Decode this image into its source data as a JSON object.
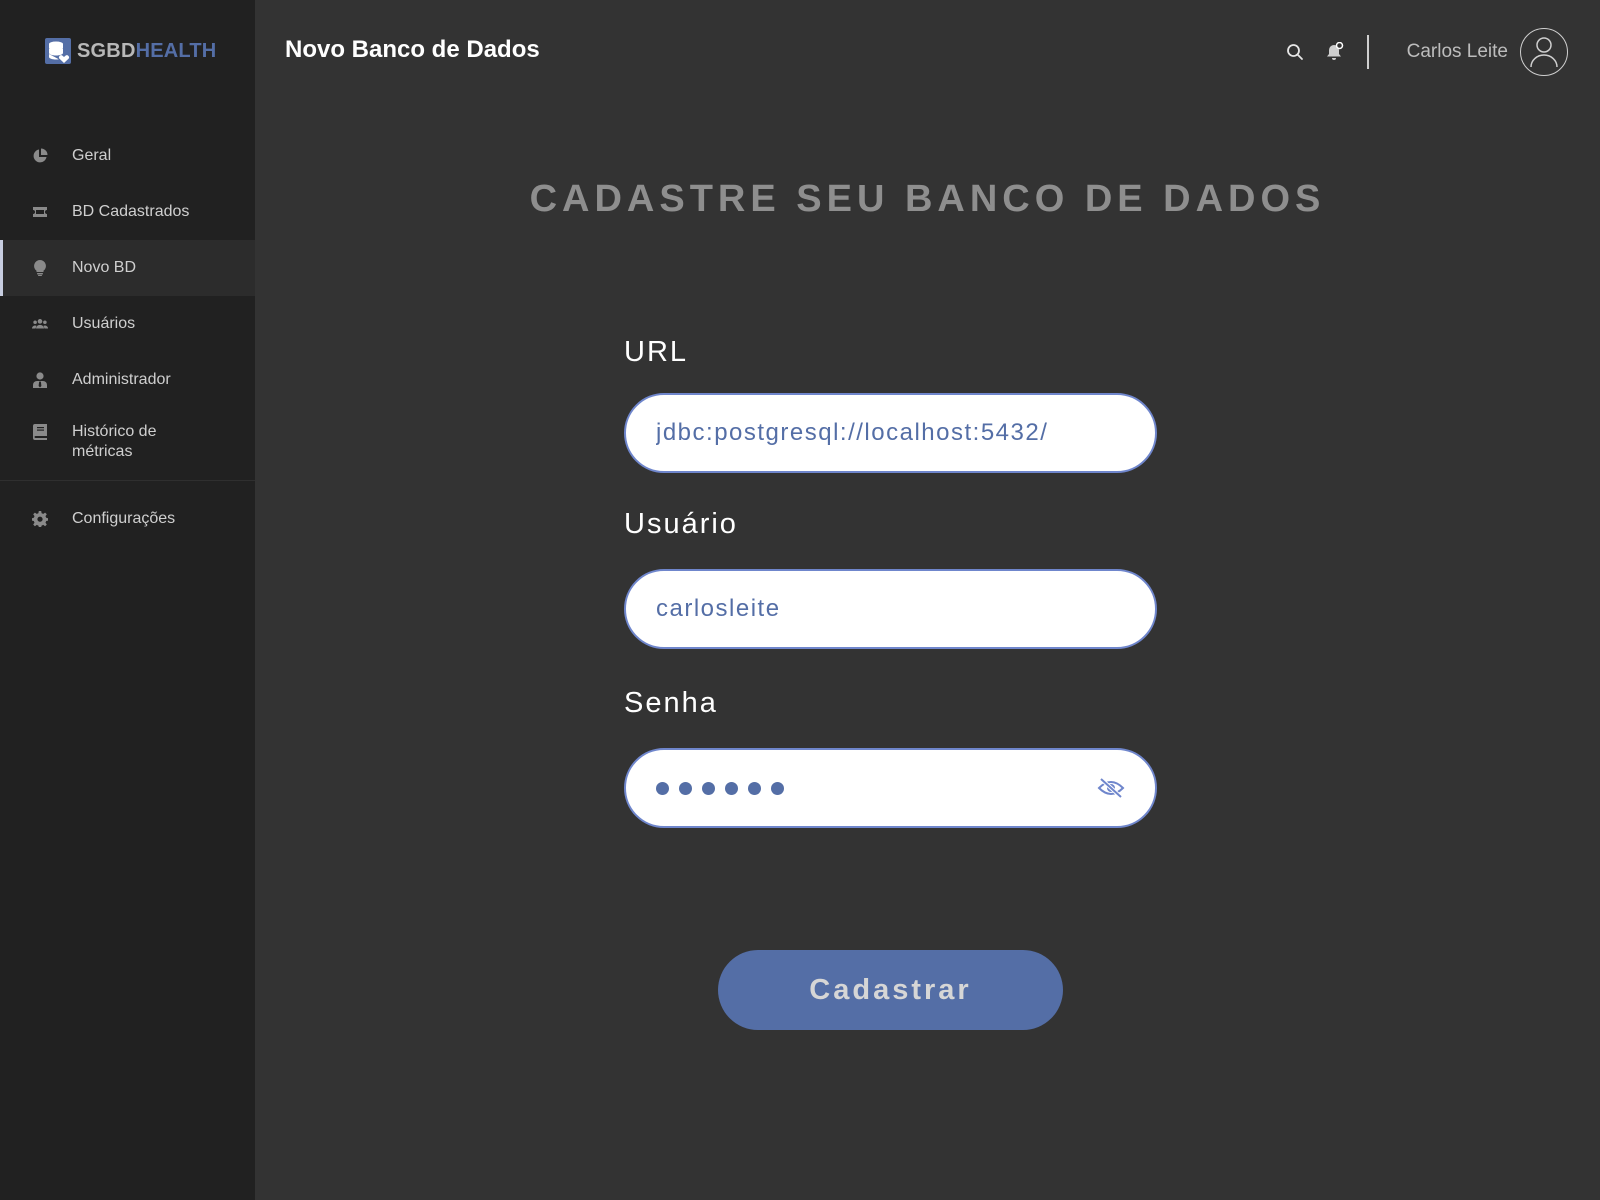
{
  "app": {
    "logo_part1": "SGBD",
    "logo_part2": "HEALTH"
  },
  "sidebar": {
    "items": [
      {
        "label": "Geral",
        "icon": "pie-chart-icon",
        "active": false
      },
      {
        "label": "BD Cadastrados",
        "icon": "ticket-icon",
        "active": false
      },
      {
        "label": "Novo BD",
        "icon": "lightbulb-icon",
        "active": true
      },
      {
        "label": "Usuários",
        "icon": "users-icon",
        "active": false
      },
      {
        "label": "Administrador",
        "icon": "user-tie-icon",
        "active": false
      },
      {
        "label": "Histórico de métricas",
        "icon": "book-icon",
        "active": false
      },
      {
        "label": "Configurações",
        "icon": "gear-icon",
        "active": false
      }
    ]
  },
  "header": {
    "title": "Novo Banco de Dados",
    "user_name": "Carlos Leite"
  },
  "form": {
    "heading": "CADASTRE SEU BANCO DE DADOS",
    "url_label": "URL",
    "url_value": "jdbc:postgresql://localhost:5432/",
    "user_label": "Usuário",
    "user_value": "carlosleite",
    "password_label": "Senha",
    "password_length": 6,
    "submit_label": "Cadastrar"
  },
  "colors": {
    "accent": "#546ea6",
    "sidebar_bg": "#212121",
    "page_bg": "#333333",
    "input_border": "#6f86cc"
  }
}
